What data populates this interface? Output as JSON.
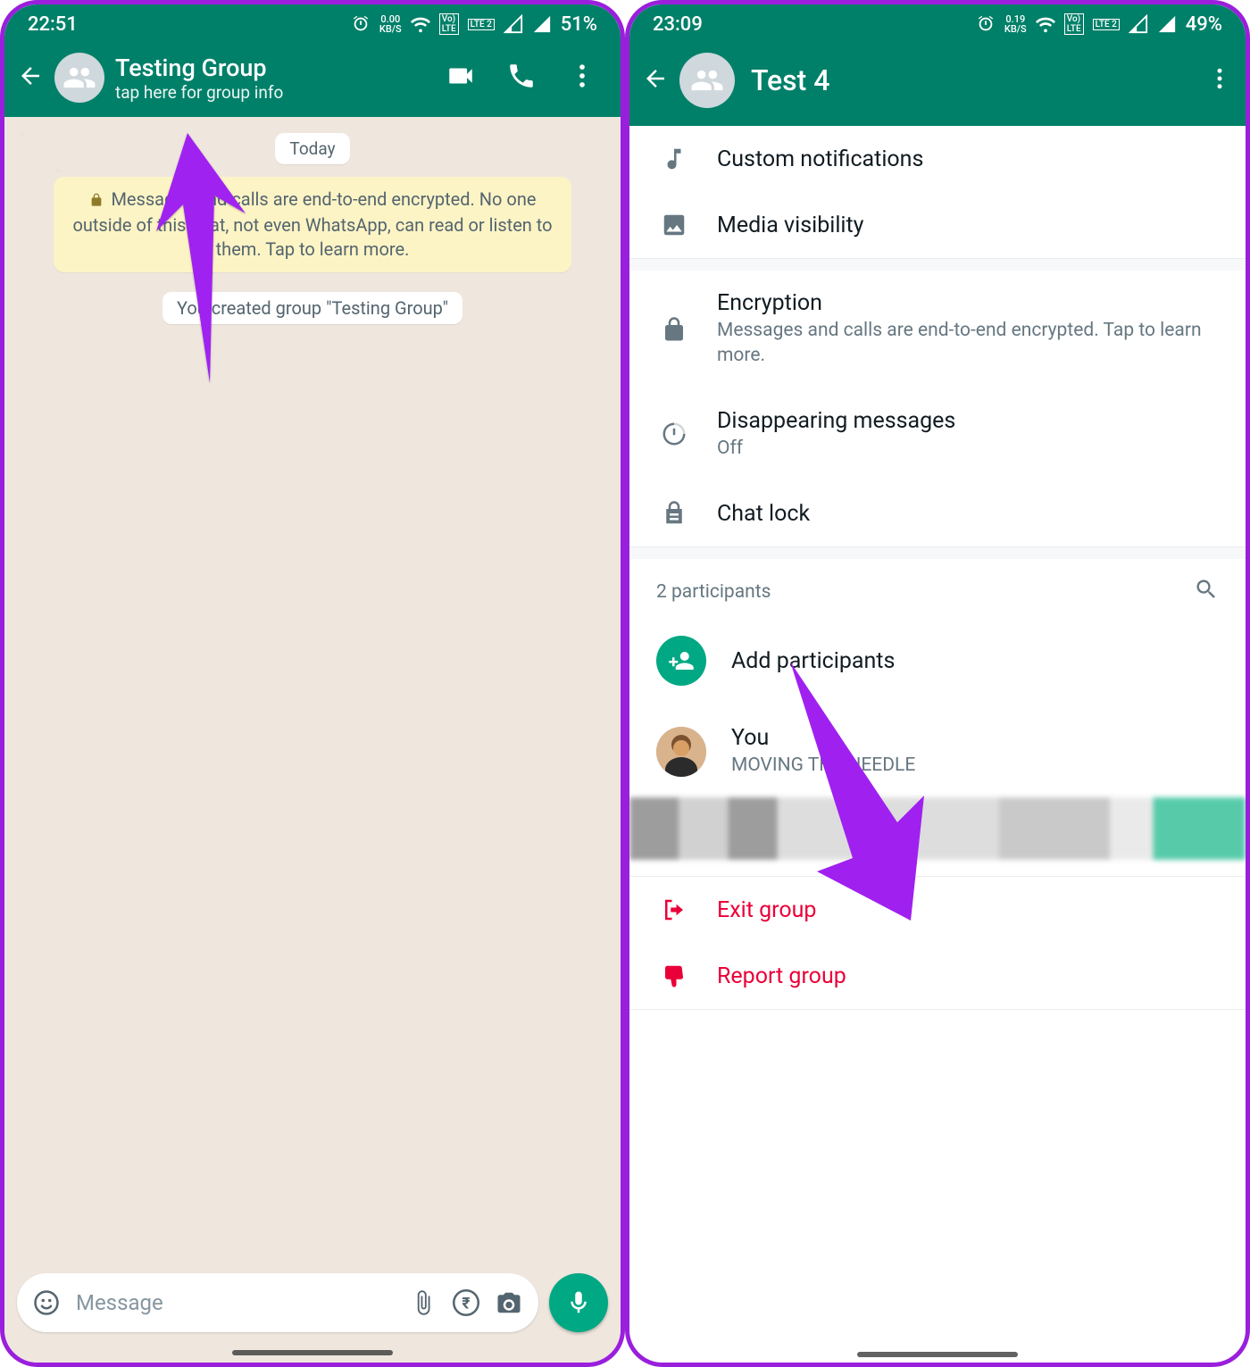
{
  "left": {
    "status": {
      "time": "22:51",
      "speed_top": "0.00",
      "speed_unit": "KB/S",
      "lte1": "Vo\nLTE",
      "lte2": "LTE 2",
      "battery": "51%"
    },
    "header": {
      "title": "Testing Group",
      "subtitle": "tap here for group info"
    },
    "chat": {
      "date_pill": "Today",
      "encryption": "Messages and calls are end-to-end encrypted. No one outside of this chat, not even WhatsApp, can read or listen to them. Tap to learn more.",
      "created_pill": "You created group \"Testing Group\""
    },
    "input": {
      "placeholder": "Message"
    }
  },
  "right": {
    "status": {
      "time": "23:09",
      "speed_top": "0.19",
      "speed_unit": "KB/S",
      "lte1": "Vo\nLTE",
      "lte2": "LTE 2",
      "battery": "49%"
    },
    "header": {
      "title": "Test 4"
    },
    "rows": {
      "notifications": "Custom notifications",
      "media": "Media visibility",
      "encryption_title": "Encryption",
      "encryption_sub": "Messages and calls are end-to-end encrypted. Tap to learn more.",
      "disappearing_title": "Disappearing messages",
      "disappearing_sub": "Off",
      "chatlock": "Chat lock"
    },
    "participants": {
      "count_label": "2 participants",
      "add": "Add participants",
      "you_name": "You",
      "you_status": "MOVING THE NEEDLE"
    },
    "actions": {
      "exit": "Exit group",
      "report": "Report group"
    }
  }
}
